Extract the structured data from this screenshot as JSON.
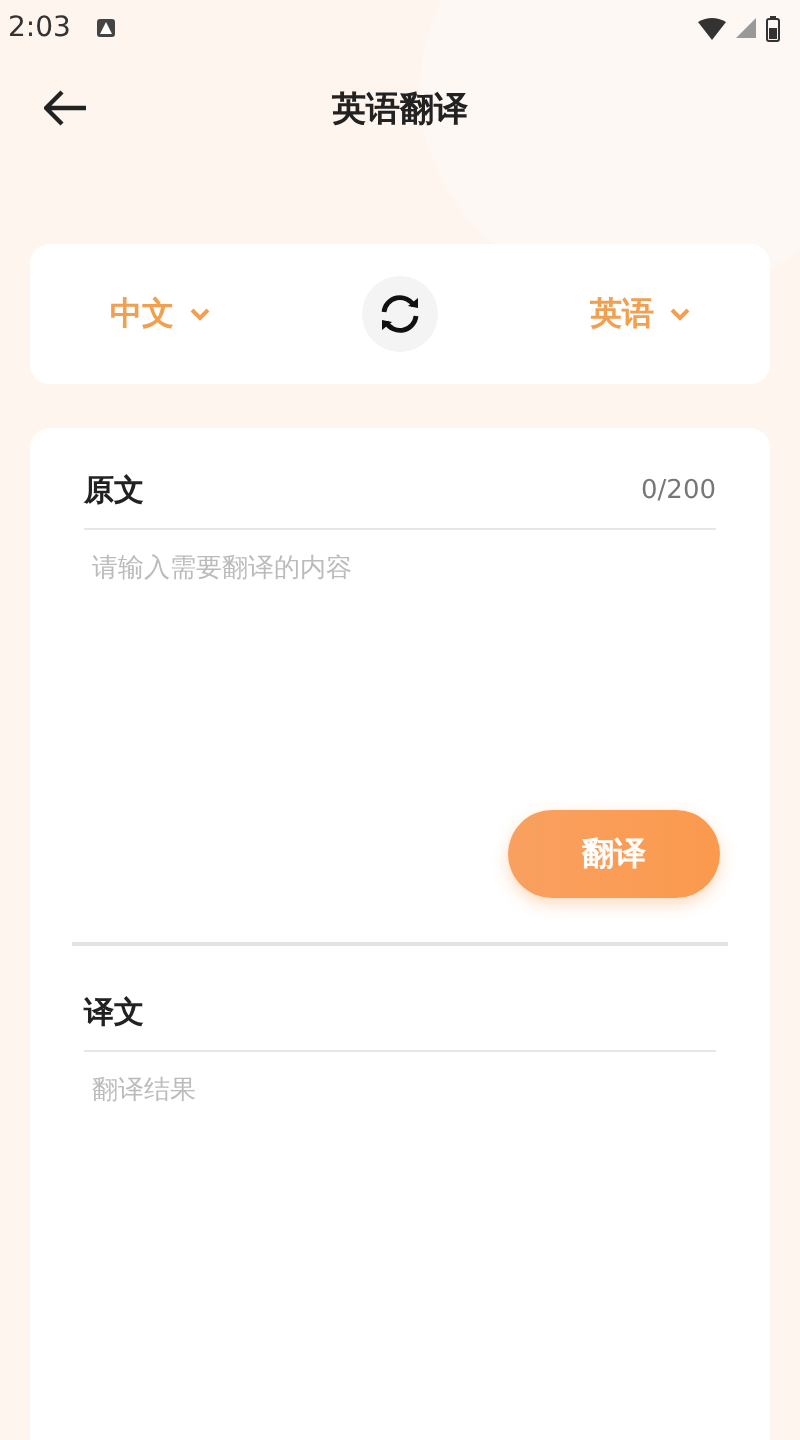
{
  "status_bar": {
    "time": "2:03"
  },
  "header": {
    "title": "英语翻译"
  },
  "languages": {
    "source": "中文",
    "target": "英语"
  },
  "source": {
    "label": "原文",
    "counter": "0/200",
    "placeholder": "请输入需要翻译的内容"
  },
  "translate_button": "翻译",
  "result": {
    "label": "译文",
    "placeholder": "翻译结果"
  }
}
